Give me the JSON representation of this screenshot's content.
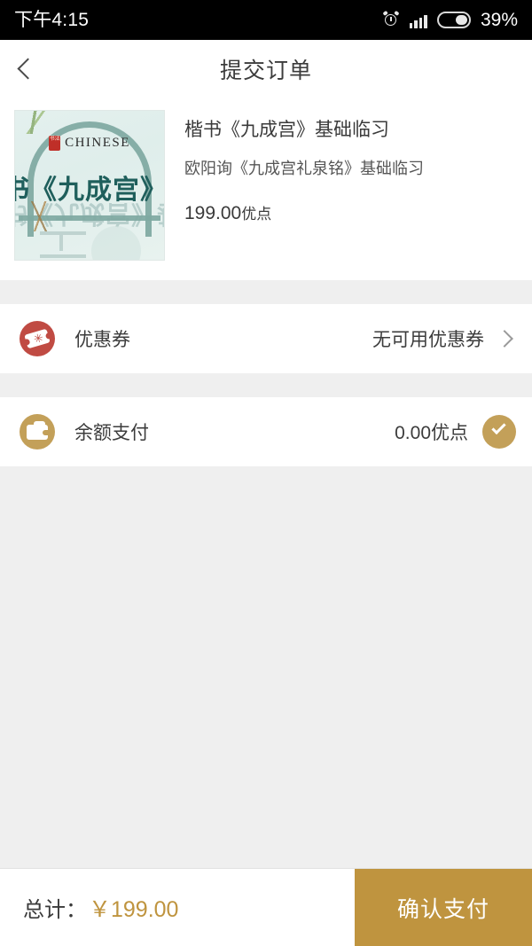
{
  "status_bar": {
    "time": "下午4:15",
    "battery_percent": "39%",
    "icons": [
      "alarm-icon",
      "signal-icon",
      "battery-icon"
    ]
  },
  "header": {
    "title": "提交订单",
    "back_icon": "chevron-left-icon"
  },
  "product": {
    "title": "楷书《九成宫》基础临习",
    "subtitle": "欧阳询《九成宫礼泉铭》基础临习",
    "price_value": "199.00",
    "price_unit": "优点",
    "thumbnail": {
      "brand_text": "CHINESE",
      "seal_text": "书法",
      "cover_text": "书《九成宫》基础临",
      "background_color": "#e4f0ee",
      "accent_color": "#7fa9a2"
    }
  },
  "coupon_row": {
    "icon": "coupon-ticket-icon",
    "icon_color": "#c04b43",
    "label": "优惠券",
    "value": "无可用优惠券",
    "chevron": "chevron-right-icon"
  },
  "balance_row": {
    "icon": "wallet-icon",
    "icon_color": "#c3a059",
    "label": "余额支付",
    "value": "0.00优点",
    "selected": true,
    "check_icon": "check-circle-icon",
    "check_color": "#c3a059"
  },
  "bottom_bar": {
    "total_label": "总计：",
    "total_amount": "￥199.00",
    "total_color": "#bf943f",
    "pay_button_label": "确认支付",
    "pay_button_color": "#bf943f"
  }
}
